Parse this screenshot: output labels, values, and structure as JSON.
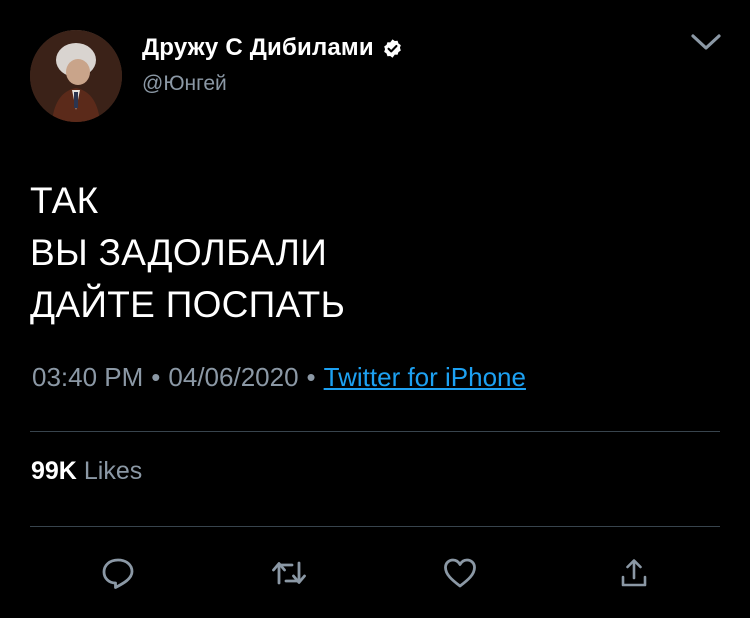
{
  "tweet": {
    "author": {
      "display_name": "Дружу С Дибилами",
      "handle": "@Юнгей",
      "verified": true
    },
    "text_lines": [
      "ТАК",
      "ВЫ ЗАДОЛБАЛИ",
      "ДАЙТЕ ПОСПАТЬ"
    ],
    "time": "03:40 PM",
    "date": "04/06/2020",
    "separator": "•",
    "source": "Twitter for iPhone",
    "stats": {
      "likes_count": "99K",
      "likes_label": "Likes"
    }
  },
  "icons": {
    "verified": "verified-badge-icon",
    "menu": "chevron-down-icon",
    "reply": "reply-icon",
    "retweet": "retweet-icon",
    "like": "heart-icon",
    "share": "share-icon"
  },
  "colors": {
    "background": "#000000",
    "primary_text": "#ffffff",
    "secondary_text": "#8b98a5",
    "link": "#1da1f2",
    "divider": "#38444d",
    "icon": "#8b98a5"
  }
}
